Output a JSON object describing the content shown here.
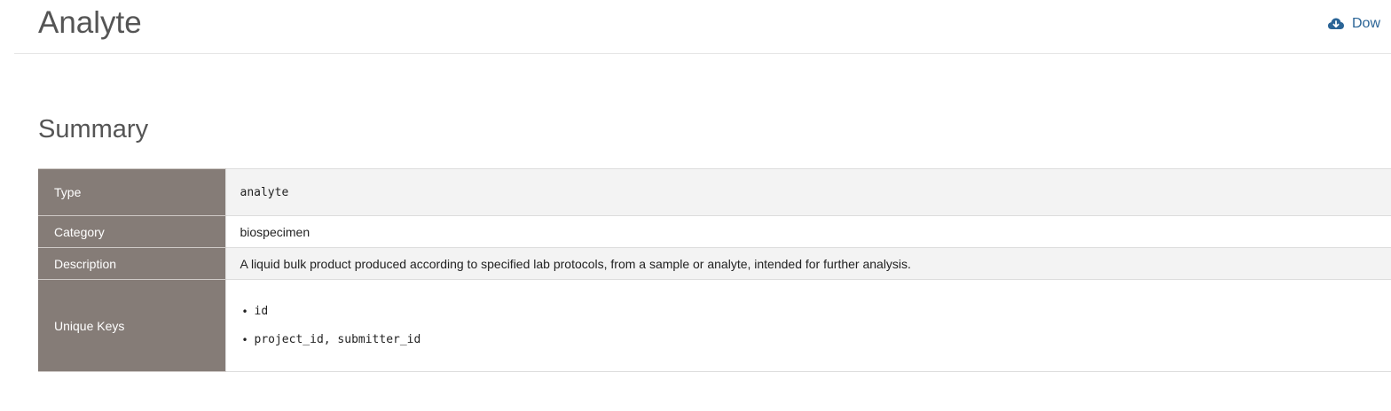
{
  "header": {
    "title": "Analyte",
    "download_label": "Dow",
    "download_icon": "cloud-download-icon"
  },
  "summary": {
    "title": "Summary",
    "rows": [
      {
        "key": "Type",
        "value": "analyte"
      },
      {
        "key": "Category",
        "value": "biospecimen"
      },
      {
        "key": "Description",
        "value": "A liquid bulk product produced according to specified lab protocols, from a sample or analyte, intended for further analysis."
      },
      {
        "key": "Unique Keys",
        "items": [
          "id",
          "project_id, submitter_id"
        ]
      }
    ]
  },
  "colors": {
    "header_cell_bg": "#857c77",
    "link": "#2a6496",
    "striped_row_bg": "#f3f3f3"
  }
}
